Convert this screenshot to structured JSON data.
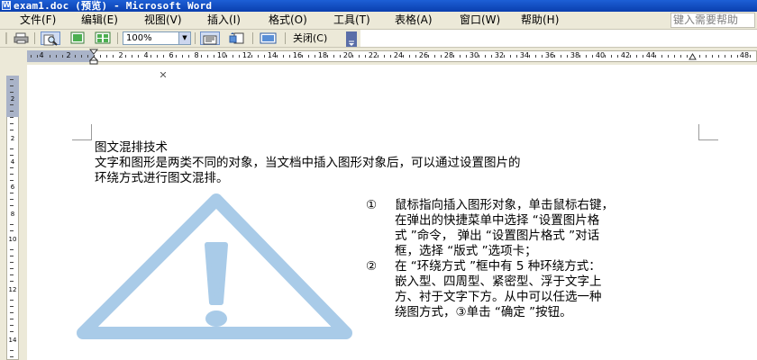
{
  "window": {
    "title": "exam1.doc (预览) - Microsoft Word",
    "app_icon": "W"
  },
  "menu": {
    "items": [
      "文件(F)",
      "编辑(E)",
      "视图(V)",
      "插入(I)",
      "格式(O)",
      "工具(T)",
      "表格(A)",
      "窗口(W)",
      "帮助(H)"
    ],
    "help_placeholder": "键入需要帮助"
  },
  "toolbar": {
    "zoom": "100%",
    "close_label": "关闭(C)",
    "icons": [
      "print-icon",
      "magnifier-icon",
      "one-page-icon",
      "multi-page-icon",
      "ruler-toggle-icon",
      "shrink-to-fit-icon",
      "full-screen-icon"
    ]
  },
  "ruler": {
    "labels": [
      "4",
      "2",
      "2",
      "4",
      "6",
      "8",
      "10",
      "12",
      "14",
      "16",
      "18",
      "20",
      "22",
      "24",
      "26",
      "28",
      "30",
      "32",
      "34",
      "36",
      "38",
      "40",
      "42",
      "44",
      "48"
    ],
    "vertical_labels": [
      "2",
      "2",
      "4",
      "6",
      "8",
      "10",
      "12",
      "14"
    ]
  },
  "document": {
    "heading": "图文混排技术",
    "para_line1": "文字和图形是两类不同的对象，当文档中插入图形对象后，可以通过设置图片的",
    "para_line2": "环绕方式进行图文混排。",
    "list": [
      {
        "num": "①",
        "lines": [
          "鼠标指向插入图形对象，单击鼠标右键，",
          "在弹出的快捷菜单中选择 “设置图片格",
          "式 ”命令， 弹出 “设置图片格式 ”对话",
          "框，选择 “版式 ”选项卡；"
        ]
      },
      {
        "num": "②",
        "lines": [
          "在 “环绕方式 ”框中有  5  种环绕方式：",
          "嵌入型、四周型、紧密型、浮于文字上",
          "方、衬于文字下方。从中可以任选一种",
          "绕图方式，③单击 “确定 ”按钮。"
        ]
      }
    ],
    "warning_icon_color": "#a9cbe8"
  },
  "colors": {
    "titlebar": "#0a3fae",
    "chrome": "#ece9d8",
    "ruler_margin": "#a9b3c8"
  }
}
